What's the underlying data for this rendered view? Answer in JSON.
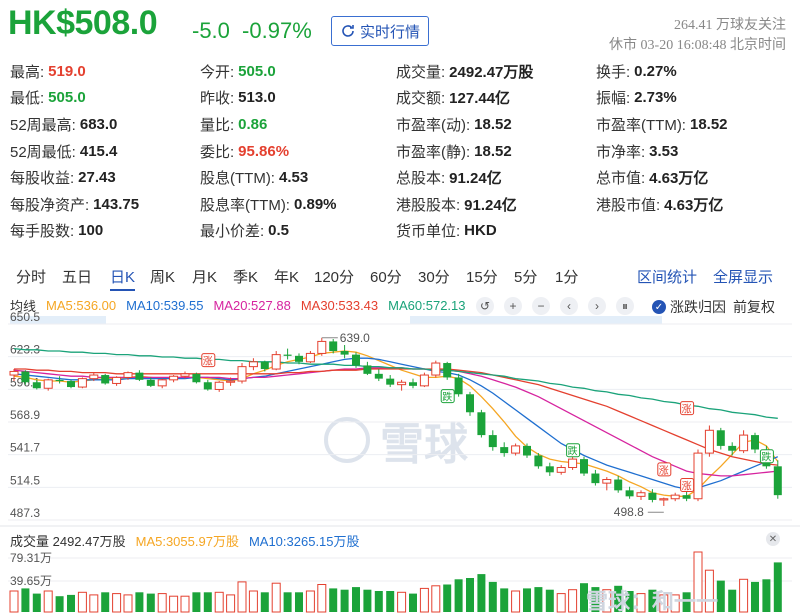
{
  "header": {
    "price": "HK$508.0",
    "change": "-5.0",
    "change_pct": "-0.97%",
    "realtime_label": "实时行情",
    "follow": "264.41 万球友关注",
    "status": "休市 03-20 16:08:48 北京时间"
  },
  "quote_rows": [
    [
      {
        "label": "最高:",
        "value": "519.0",
        "color": "red"
      },
      {
        "label": "今开:",
        "value": "505.0",
        "color": "green"
      },
      {
        "label": "成交量:",
        "value": "2492.47万股",
        "color": ""
      },
      {
        "label": "换手:",
        "value": "0.27%",
        "color": ""
      }
    ],
    [
      {
        "label": "最低:",
        "value": "505.0",
        "color": "green"
      },
      {
        "label": "昨收:",
        "value": "513.0",
        "color": ""
      },
      {
        "label": "成交额:",
        "value": "127.44亿",
        "color": ""
      },
      {
        "label": "振幅:",
        "value": "2.73%",
        "color": ""
      }
    ],
    [
      {
        "label": "52周最高:",
        "value": "683.0",
        "color": ""
      },
      {
        "label": "量比:",
        "value": "0.86",
        "color": "green"
      },
      {
        "label": "市盈率(动):",
        "value": "18.52",
        "color": ""
      },
      {
        "label": "市盈率(TTM):",
        "value": "18.52",
        "color": ""
      }
    ],
    [
      {
        "label": "52周最低:",
        "value": "415.4",
        "color": ""
      },
      {
        "label": "委比:",
        "value": "95.86%",
        "color": "red"
      },
      {
        "label": "市盈率(静):",
        "value": "18.52",
        "color": ""
      },
      {
        "label": "市净率:",
        "value": "3.53",
        "color": ""
      }
    ],
    [
      {
        "label": "每股收益:",
        "value": "27.43",
        "color": ""
      },
      {
        "label": "股息(TTM):",
        "value": "4.53",
        "color": ""
      },
      {
        "label": "总股本:",
        "value": "91.24亿",
        "color": ""
      },
      {
        "label": "总市值:",
        "value": "4.63万亿",
        "color": ""
      }
    ],
    [
      {
        "label": "每股净资产:",
        "value": "143.75",
        "color": ""
      },
      {
        "label": "股息率(TTM):",
        "value": "0.89%",
        "color": ""
      },
      {
        "label": "港股股本:",
        "value": "91.24亿",
        "color": ""
      },
      {
        "label": "港股市值:",
        "value": "4.63万亿",
        "color": ""
      }
    ],
    [
      {
        "label": "每手股数:",
        "value": "100",
        "color": ""
      },
      {
        "label": "最小价差:",
        "value": "0.5",
        "color": ""
      },
      {
        "label": "货币单位:",
        "value": "HKD",
        "color": ""
      },
      null
    ]
  ],
  "tabs": {
    "items": [
      "分时",
      "五日",
      "日K",
      "周K",
      "月K",
      "季K",
      "年K",
      "120分",
      "60分",
      "30分",
      "15分",
      "5分",
      "1分"
    ],
    "active": "日K",
    "interval_stats": "区间统计",
    "fullscreen": "全屏显示"
  },
  "ma_legend": {
    "title": "均线",
    "items": [
      {
        "label": "MA5:536.00",
        "color": "#f5a623"
      },
      {
        "label": "MA10:539.55",
        "color": "#1f6fd0"
      },
      {
        "label": "MA20:527.88",
        "color": "#d6249f"
      },
      {
        "label": "MA30:533.43",
        "color": "#e4402f"
      },
      {
        "label": "MA60:572.13",
        "color": "#1ba37a"
      }
    ],
    "option_rise_fall": "涨跌归因",
    "option_adjust": "前复权"
  },
  "chart_data": {
    "type": "candlestick",
    "y_ticks": [
      "650.5",
      "623.3",
      "596.1",
      "568.9",
      "541.7",
      "514.5",
      "487.3"
    ],
    "ylim": [
      487.3,
      650.5
    ],
    "annotations": [
      {
        "label": "639.0"
      },
      {
        "label": "498.8"
      }
    ],
    "markers": {
      "rise": "涨",
      "fall": "跌"
    },
    "candles": [
      [
        608,
        613,
        603,
        611
      ],
      [
        611,
        612,
        600,
        602
      ],
      [
        602,
        604,
        596,
        597
      ],
      [
        597,
        605,
        595,
        604
      ],
      [
        604,
        607,
        601,
        603
      ],
      [
        603,
        604,
        597,
        598
      ],
      [
        598,
        606,
        597,
        605
      ],
      [
        605,
        610,
        603,
        608
      ],
      [
        608,
        609,
        600,
        601
      ],
      [
        601,
        607,
        599,
        606
      ],
      [
        606,
        611,
        604,
        610
      ],
      [
        610,
        612,
        603,
        604
      ],
      [
        604,
        606,
        598,
        599
      ],
      [
        599,
        605,
        597,
        604
      ],
      [
        604,
        608,
        602,
        607
      ],
      [
        607,
        611,
        605,
        609
      ],
      [
        609,
        610,
        601,
        602
      ],
      [
        602,
        604,
        595,
        596
      ],
      [
        596,
        603,
        594,
        602
      ],
      [
        602,
        606,
        599,
        603
      ],
      [
        603,
        618,
        601,
        615
      ],
      [
        615,
        622,
        612,
        619
      ],
      [
        619,
        620,
        611,
        613
      ],
      [
        613,
        628,
        612,
        625
      ],
      [
        625,
        630,
        621,
        624
      ],
      [
        624,
        626,
        617,
        619
      ],
      [
        619,
        628,
        618,
        626
      ],
      [
        626,
        639,
        624,
        636
      ],
      [
        636,
        638,
        626,
        628
      ],
      [
        628,
        633,
        622,
        625
      ],
      [
        625,
        627,
        614,
        616
      ],
      [
        616,
        619,
        608,
        609
      ],
      [
        609,
        613,
        603,
        605
      ],
      [
        605,
        608,
        598,
        600
      ],
      [
        600,
        604,
        595,
        602
      ],
      [
        602,
        605,
        597,
        599
      ],
      [
        599,
        610,
        598,
        608
      ],
      [
        608,
        620,
        606,
        618
      ],
      [
        618,
        619,
        604,
        606
      ],
      [
        606,
        609,
        590,
        592
      ],
      [
        592,
        594,
        574,
        577
      ],
      [
        577,
        579,
        556,
        558
      ],
      [
        558,
        562,
        545,
        548
      ],
      [
        548,
        552,
        540,
        543
      ],
      [
        543,
        551,
        541,
        549
      ],
      [
        549,
        551,
        539,
        541
      ],
      [
        541,
        543,
        530,
        532
      ],
      [
        532,
        535,
        524,
        527
      ],
      [
        527,
        533,
        525,
        531
      ],
      [
        531,
        540,
        529,
        538
      ],
      [
        538,
        540,
        524,
        526
      ],
      [
        526,
        529,
        516,
        518
      ],
      [
        518,
        523,
        512,
        521
      ],
      [
        521,
        524,
        510,
        512
      ],
      [
        512,
        515,
        505,
        507
      ],
      [
        507,
        512,
        504,
        510
      ],
      [
        510,
        513,
        502,
        504
      ],
      [
        504,
        506,
        499,
        505
      ],
      [
        505,
        510,
        503,
        508
      ],
      [
        508,
        512,
        503,
        505
      ],
      [
        505,
        546,
        503,
        543
      ],
      [
        543,
        566,
        540,
        562
      ],
      [
        562,
        564,
        546,
        549
      ],
      [
        549,
        552,
        541,
        545
      ],
      [
        545,
        562,
        543,
        558
      ],
      [
        558,
        560,
        543,
        546
      ],
      [
        546,
        549,
        530,
        532
      ],
      [
        532,
        537,
        505,
        508
      ]
    ],
    "ma": {
      "MA5": [
        607,
        606,
        604,
        603,
        603,
        602,
        603,
        604,
        605,
        605,
        606,
        607,
        606,
        605,
        605,
        606,
        606,
        605,
        604,
        603,
        605,
        609,
        612,
        616,
        619,
        621,
        623,
        626,
        627,
        628,
        627,
        624,
        620,
        616,
        612,
        609,
        606,
        606,
        607,
        605,
        599,
        590,
        580,
        569,
        557,
        548,
        542,
        538,
        536,
        535,
        534,
        531,
        528,
        524,
        519,
        515,
        510,
        508,
        507,
        507,
        513,
        523,
        532,
        542,
        552,
        554,
        549,
        536
      ],
      "MA10": [
        609,
        608,
        607,
        606,
        605,
        604,
        604,
        604,
        604,
        604,
        605,
        605,
        605,
        605,
        605,
        605,
        606,
        606,
        605,
        604,
        605,
        606,
        607,
        609,
        611,
        613,
        615,
        617,
        619,
        621,
        622,
        622,
        621,
        619,
        617,
        615,
        613,
        611,
        610,
        608,
        604,
        599,
        593,
        586,
        579,
        572,
        565,
        558,
        551,
        546,
        541,
        537,
        533,
        530,
        527,
        524,
        521,
        518,
        515,
        513,
        514,
        517,
        520,
        524,
        528,
        532,
        536,
        540
      ],
      "MA20": [
        612,
        611,
        610,
        609,
        608,
        607,
        607,
        606,
        606,
        606,
        606,
        606,
        606,
        606,
        606,
        606,
        606,
        606,
        606,
        605,
        605,
        606,
        606,
        607,
        608,
        609,
        610,
        611,
        612,
        613,
        613,
        614,
        614,
        614,
        614,
        613,
        613,
        612,
        612,
        611,
        609,
        607,
        604,
        601,
        598,
        594,
        590,
        585,
        580,
        575,
        570,
        565,
        560,
        555,
        550,
        545,
        540,
        536,
        532,
        528,
        526,
        525,
        524,
        524,
        525,
        526,
        527,
        528
      ],
      "MA30": [
        613,
        613,
        612,
        612,
        611,
        611,
        610,
        610,
        610,
        609,
        609,
        609,
        609,
        609,
        609,
        609,
        609,
        609,
        609,
        609,
        609,
        609,
        609,
        609,
        610,
        610,
        611,
        611,
        612,
        612,
        612,
        613,
        613,
        613,
        613,
        613,
        613,
        613,
        613,
        612,
        611,
        610,
        608,
        606,
        604,
        602,
        600,
        597,
        594,
        591,
        588,
        585,
        582,
        578,
        574,
        570,
        566,
        562,
        558,
        554,
        550,
        546,
        543,
        540,
        538,
        536,
        534,
        533
      ],
      "MA60": [
        630,
        629,
        629,
        628,
        628,
        627,
        627,
        626,
        626,
        625,
        625,
        624,
        624,
        623,
        623,
        622,
        622,
        621,
        621,
        620,
        620,
        619,
        619,
        619,
        618,
        618,
        617,
        617,
        617,
        616,
        616,
        615,
        615,
        614,
        614,
        613,
        613,
        612,
        612,
        611,
        610,
        609,
        608,
        607,
        605,
        604,
        603,
        601,
        600,
        598,
        597,
        595,
        594,
        592,
        591,
        589,
        588,
        586,
        585,
        583,
        582,
        580,
        579,
        577,
        576,
        575,
        573,
        572
      ]
    },
    "volume": {
      "legend": "成交量 2492.47万股",
      "ma5": "MA5:3055.97万股",
      "ma10": "MA10:3265.15万股",
      "y_ticks": [
        "79.31万",
        "39.65万"
      ]
    }
  },
  "colors": {
    "up": "#e4402f",
    "down": "#1ba33a",
    "accent": "#2454b5"
  },
  "watermark": {
    "main": "雪球",
    "corner": "雪球：和一一"
  }
}
